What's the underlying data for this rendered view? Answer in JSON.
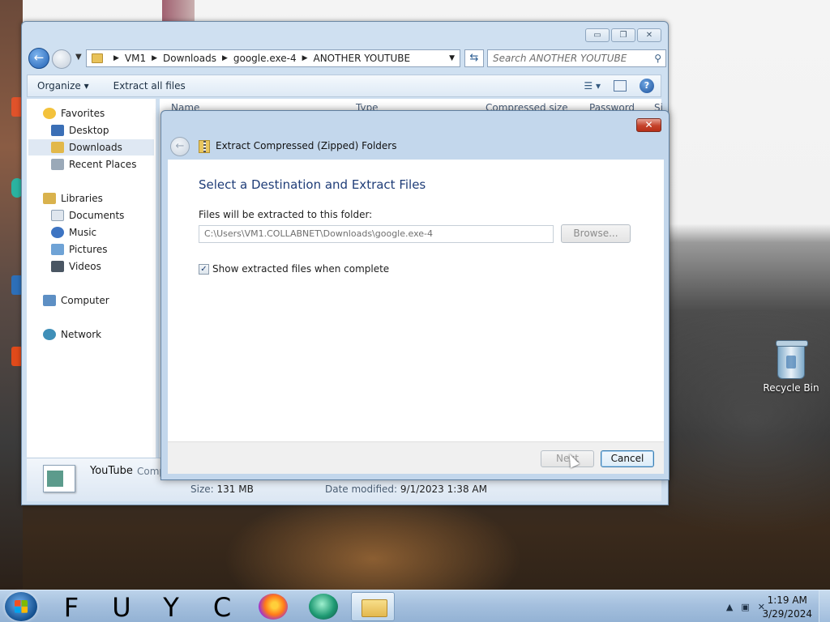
{
  "desktop": {
    "recycle_bin_label": "Recycle Bin"
  },
  "explorer": {
    "breadcrumb": [
      "VM1",
      "Downloads",
      "google.exe-4",
      "ANOTHER YOUTUBE"
    ],
    "search_placeholder": "Search ANOTHER YOUTUBE",
    "toolbar": {
      "organize": "Organize",
      "extract_all": "Extract all files"
    },
    "nav": {
      "favorites": "Favorites",
      "desktop": "Desktop",
      "downloads": "Downloads",
      "recent_places": "Recent Places",
      "libraries": "Libraries",
      "documents": "Documents",
      "music": "Music",
      "pictures": "Pictures",
      "videos": "Videos",
      "computer": "Computer",
      "network": "Network"
    },
    "columns": [
      "Name",
      "Type",
      "Compressed size",
      "Password",
      "Si"
    ],
    "details": {
      "name": "YouTube",
      "type": "Comp",
      "size_label": "Size:",
      "size_value": "131 MB",
      "date_label": "Date modified:",
      "date_value": "9/1/2023 1:38 AM"
    }
  },
  "dialog": {
    "title": "Extract Compressed (Zipped) Folders",
    "heading": "Select a Destination and Extract Files",
    "dest_label": "Files will be extracted to this folder:",
    "dest_path": "C:\\Users\\VM1.COLLABNET\\Downloads\\google.exe-4",
    "browse_label": "Browse...",
    "show_files_label": "Show extracted files when complete",
    "show_files_checked": true,
    "next_label": "Next",
    "cancel_label": "Cancel"
  },
  "taskbar": {
    "pinned_letters": [
      "F",
      "U",
      "Y",
      "C"
    ],
    "time": "1:19 AM",
    "date": "3/29/2024"
  }
}
